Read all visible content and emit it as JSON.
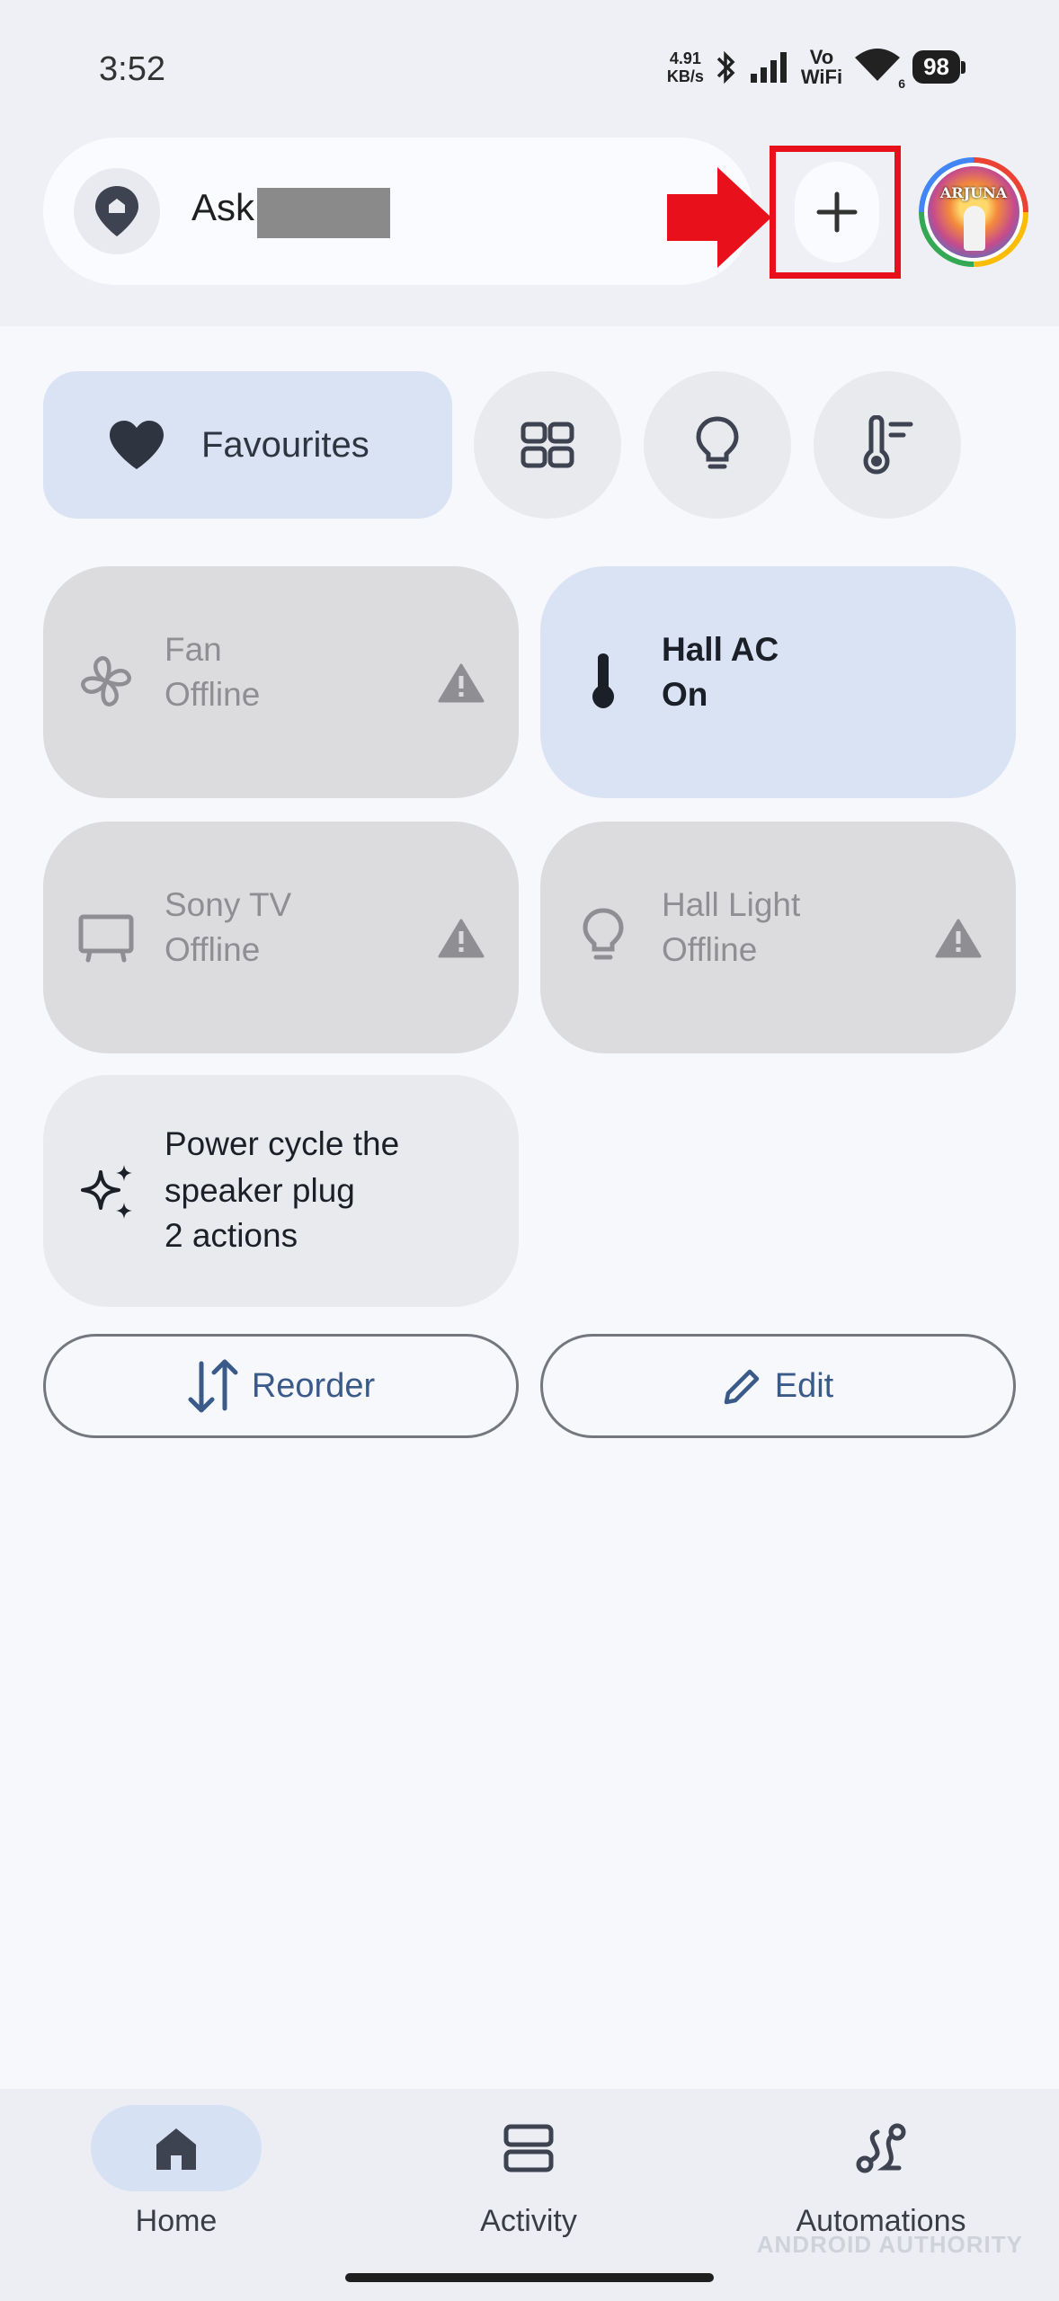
{
  "status_bar": {
    "time": "3:52",
    "net_speed_value": "4.91",
    "net_speed_unit": "KB/s",
    "volte_top": "Vo",
    "volte_bottom": "WiFi",
    "wifi_sub": "6",
    "battery": "98"
  },
  "header": {
    "search_label": "Ask",
    "search_icon": "home-pin-icon",
    "add_icon": "plus-icon",
    "avatar_name": "ARJUNA",
    "highlight_color": "#e8101a"
  },
  "chips": {
    "favourites_label": "Favourites",
    "icons": [
      "grid-icon",
      "lightbulb-icon",
      "thermostat-icon"
    ]
  },
  "tiles": [
    {
      "name": "Fan",
      "status": "Offline",
      "icon": "fan-icon",
      "warning": true
    },
    {
      "name": "Hall AC",
      "status": "On",
      "icon": "thermometer-icon",
      "warning": false
    },
    {
      "name": "Sony TV",
      "status": "Offline",
      "icon": "tv-icon",
      "warning": true
    },
    {
      "name": "Hall Light",
      "status": "Offline",
      "icon": "lightbulb-icon",
      "warning": true
    }
  ],
  "automation_tile": {
    "line1": "Power cycle the",
    "line2": "speaker plug",
    "line3": "2 actions",
    "icon": "sparkle-icon"
  },
  "actions": {
    "reorder_label": "Reorder",
    "edit_label": "Edit"
  },
  "bottom_nav": {
    "home_label": "Home",
    "activity_label": "Activity",
    "automations_label": "Automations"
  },
  "watermark": "ANDROID AUTHORITY",
  "colors": {
    "accent_blue": "#dae3f3",
    "offline_tile": "#dcdcde",
    "background": "#f7f8fc"
  }
}
